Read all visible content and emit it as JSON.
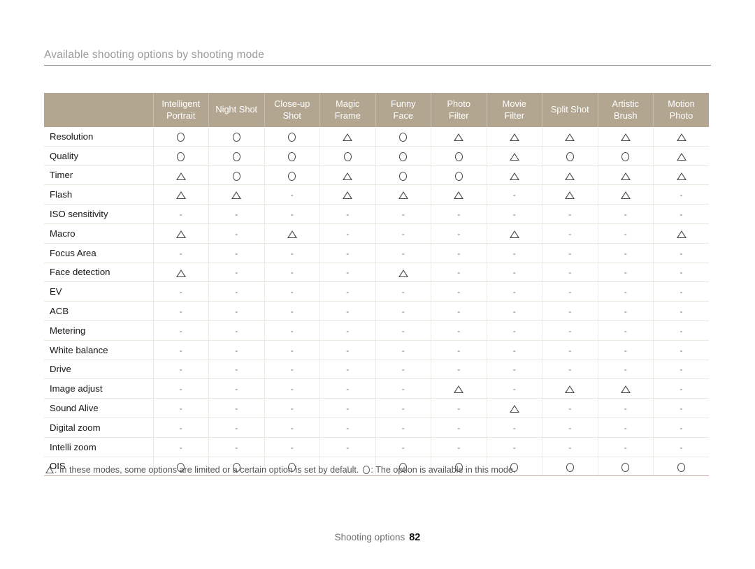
{
  "section": {
    "title": "Available shooting options by shooting mode"
  },
  "table": {
    "corner_label": "",
    "columns": [
      {
        "line1": "Intelligent",
        "line2": "Portrait"
      },
      {
        "line1": "Night Shot",
        "line2": ""
      },
      {
        "line1": "Close-up",
        "line2": "Shot"
      },
      {
        "line1": "Magic",
        "line2": "Frame"
      },
      {
        "line1": "Funny",
        "line2": "Face"
      },
      {
        "line1": "Photo",
        "line2": "Filter"
      },
      {
        "line1": "Movie",
        "line2": "Filter"
      },
      {
        "line1": "Split Shot",
        "line2": ""
      },
      {
        "line1": "Artistic",
        "line2": "Brush"
      },
      {
        "line1": "Motion",
        "line2": "Photo"
      }
    ],
    "rows": [
      {
        "label": "Resolution",
        "cells": [
          "circle",
          "circle",
          "circle",
          "triangle",
          "circle",
          "triangle",
          "triangle",
          "triangle",
          "triangle",
          "triangle"
        ]
      },
      {
        "label": "Quality",
        "cells": [
          "circle",
          "circle",
          "circle",
          "circle",
          "circle",
          "circle",
          "triangle",
          "circle",
          "circle",
          "triangle"
        ]
      },
      {
        "label": "Timer",
        "cells": [
          "triangle",
          "circle",
          "circle",
          "triangle",
          "circle",
          "circle",
          "triangle",
          "triangle",
          "triangle",
          "triangle"
        ]
      },
      {
        "label": "Flash",
        "cells": [
          "triangle",
          "triangle",
          "dash",
          "triangle",
          "triangle",
          "triangle",
          "dash",
          "triangle",
          "triangle",
          "dash"
        ]
      },
      {
        "label": "ISO sensitivity",
        "cells": [
          "dash",
          "dash",
          "dash",
          "dash",
          "dash",
          "dash",
          "dash",
          "dash",
          "dash",
          "dash"
        ]
      },
      {
        "label": "Macro",
        "cells": [
          "triangle",
          "dash",
          "triangle",
          "dash",
          "dash",
          "dash",
          "triangle",
          "dash",
          "dash",
          "triangle"
        ]
      },
      {
        "label": "Focus Area",
        "cells": [
          "dash",
          "dash",
          "dash",
          "dash",
          "dash",
          "dash",
          "dash",
          "dash",
          "dash",
          "dash"
        ]
      },
      {
        "label": "Face detection",
        "cells": [
          "triangle",
          "dash",
          "dash",
          "dash",
          "triangle",
          "dash",
          "dash",
          "dash",
          "dash",
          "dash"
        ]
      },
      {
        "label": "EV",
        "cells": [
          "dash",
          "dash",
          "dash",
          "dash",
          "dash",
          "dash",
          "dash",
          "dash",
          "dash",
          "dash"
        ]
      },
      {
        "label": "ACB",
        "cells": [
          "dash",
          "dash",
          "dash",
          "dash",
          "dash",
          "dash",
          "dash",
          "dash",
          "dash",
          "dash"
        ]
      },
      {
        "label": "Metering",
        "cells": [
          "dash",
          "dash",
          "dash",
          "dash",
          "dash",
          "dash",
          "dash",
          "dash",
          "dash",
          "dash"
        ]
      },
      {
        "label": "White balance",
        "cells": [
          "dash",
          "dash",
          "dash",
          "dash",
          "dash",
          "dash",
          "dash",
          "dash",
          "dash",
          "dash"
        ]
      },
      {
        "label": "Drive",
        "cells": [
          "dash",
          "dash",
          "dash",
          "dash",
          "dash",
          "dash",
          "dash",
          "dash",
          "dash",
          "dash"
        ]
      },
      {
        "label": "Image adjust",
        "cells": [
          "dash",
          "dash",
          "dash",
          "dash",
          "dash",
          "triangle",
          "dash",
          "triangle",
          "triangle",
          "dash"
        ]
      },
      {
        "label": "Sound Alive",
        "cells": [
          "dash",
          "dash",
          "dash",
          "dash",
          "dash",
          "dash",
          "triangle",
          "dash",
          "dash",
          "dash"
        ]
      },
      {
        "label": "Digital zoom",
        "cells": [
          "dash",
          "dash",
          "dash",
          "dash",
          "dash",
          "dash",
          "dash",
          "dash",
          "dash",
          "dash"
        ]
      },
      {
        "label": "Intelli zoom",
        "cells": [
          "dash",
          "dash",
          "dash",
          "dash",
          "dash",
          "dash",
          "dash",
          "dash",
          "dash",
          "dash"
        ]
      },
      {
        "label": "OIS",
        "cells": [
          "circle",
          "circle",
          "circle",
          "dash",
          "circle",
          "circle",
          "circle",
          "circle",
          "circle",
          "circle"
        ]
      }
    ]
  },
  "footnote": {
    "triangle_text": ": In these modes, some options are limited or a certain option is set by default.",
    "circle_text": ": The option is available in this mode."
  },
  "footer": {
    "label": "Shooting options",
    "page_number": "82"
  },
  "colors": {
    "header_bg": "#b2a691",
    "header_text": "#ffffff",
    "rule": "#8d8d8d",
    "bottom_rule": "#c9ab9a",
    "body_text": "#1d1d1d",
    "muted_text": "#9a9a9a"
  }
}
